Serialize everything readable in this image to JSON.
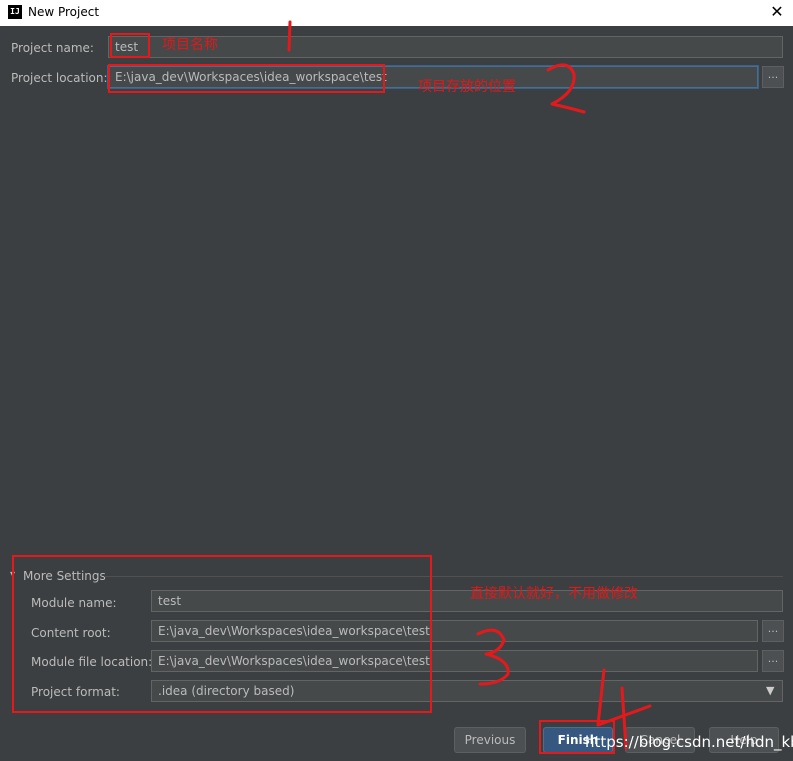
{
  "window": {
    "logo": "IJ",
    "title": "New Project",
    "close_glyph": "✕"
  },
  "project": {
    "name_label": "Project name:",
    "name_value": "test",
    "location_label": "Project location:",
    "location_value": "E:\\java_dev\\Workspaces\\idea_workspace\\test",
    "browse_glyph": "..."
  },
  "more_settings": {
    "label": "More Settings",
    "toggle_glyph": "▾",
    "module_name_label": "Module name:",
    "module_name_value": "test",
    "content_root_label": "Content root:",
    "content_root_value": "E:\\java_dev\\Workspaces\\idea_workspace\\test",
    "module_file_label": "Module file location:",
    "module_file_value": "E:\\java_dev\\Workspaces\\idea_workspace\\test",
    "format_label": "Project format:",
    "format_value": ".idea (directory based)",
    "format_dropdown_glyph": "▼",
    "browse_glyph": "..."
  },
  "buttons": {
    "previous": "Previous",
    "finish": "Finish",
    "cancel": "Cancel",
    "help": "Help"
  },
  "annotations": {
    "name_note": "项目名称",
    "location_note": "项目存放的位置",
    "settings_note": "直接默认就好，不用做修改"
  },
  "watermark": "https://blog.csdn.net/hdn_kb",
  "colors": {
    "annotation_red": "#e5191b",
    "dialog_bg": "#3c3f41",
    "finish_blue": "#365880"
  }
}
